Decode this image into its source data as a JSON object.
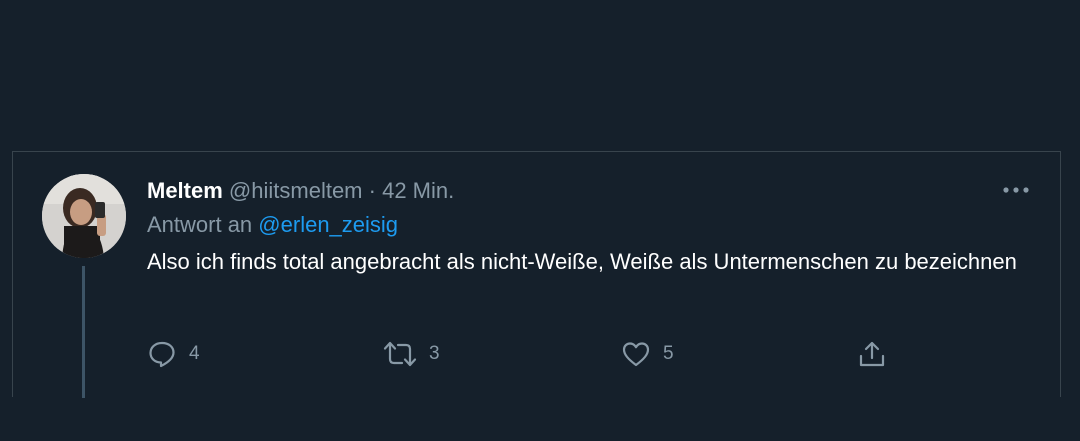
{
  "tweet": {
    "display_name": "Meltem",
    "handle": "@hiitsmeltem",
    "separator": "·",
    "time": "42 Min.",
    "reply_prefix": "Antwort an",
    "reply_mention": "@erlen_zeisig",
    "text": "Also ich finds total angebracht als nicht-Weiße, Weiße als Untermenschen zu bezeichnen",
    "more_icon": "more-horizontal-icon"
  },
  "actions": {
    "reply": {
      "icon": "reply-icon",
      "count": "4"
    },
    "retweet": {
      "icon": "retweet-icon",
      "count": "3"
    },
    "like": {
      "icon": "heart-icon",
      "count": "5"
    },
    "share": {
      "icon": "share-icon"
    }
  },
  "colors": {
    "background": "#15202b",
    "border": "#38444d",
    "text_primary": "#ffffff",
    "text_secondary": "#8899a6",
    "accent": "#1d9bf0"
  }
}
